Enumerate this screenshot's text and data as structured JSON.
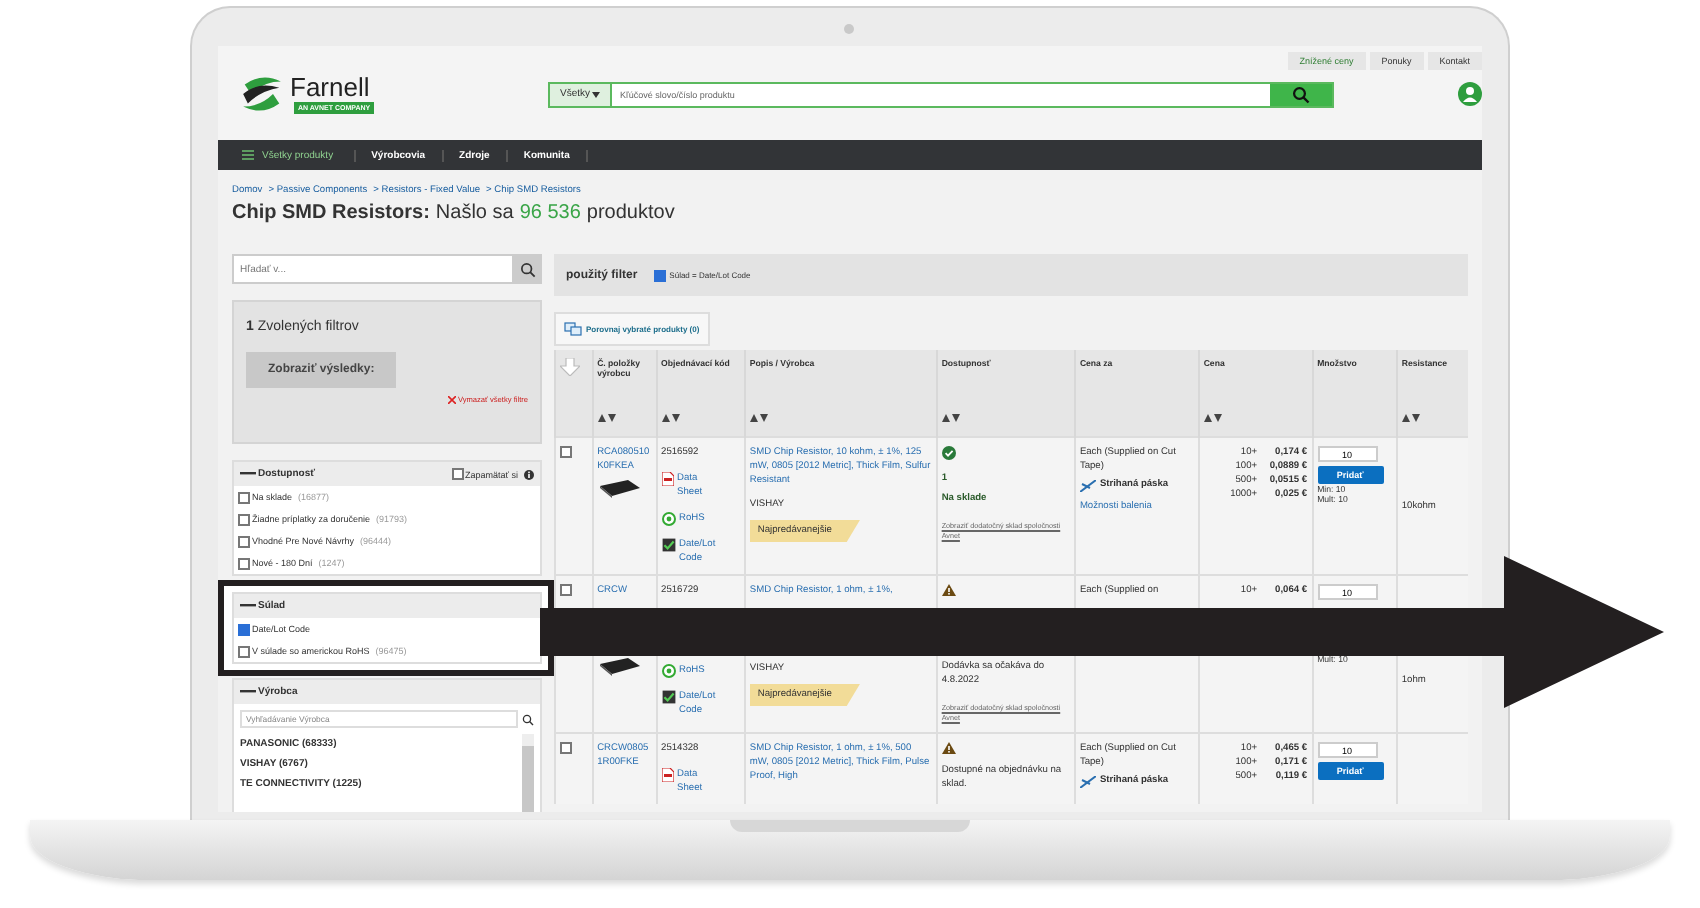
{
  "header": {
    "top_links": [
      "Znížené ceny",
      "Ponuky",
      "Kontakt"
    ],
    "logo": {
      "name": "Farnell",
      "tagline": "AN AVNET COMPANY"
    },
    "search": {
      "scope": "Všetky",
      "placeholder": "Kľúčové slovo/číslo produktu"
    }
  },
  "nav": {
    "menu_label": "Všetky produkty",
    "items": [
      "Výrobcovia",
      "Zdroje",
      "Komunita"
    ]
  },
  "breadcrumb": [
    "Domov",
    "> Passive Components",
    "> Resistors - Fixed Value",
    "> Chip SMD Resistors"
  ],
  "heading": {
    "category": "Chip SMD Resistors:",
    "found_prefix": "Našlo sa",
    "count": "96 536",
    "found_suffix": "produktov"
  },
  "sidebar": {
    "search_placeholder": "Hľadať v...",
    "selected_count": "1",
    "selected_label": "Zvolených filtrov",
    "show_button": "Zobraziť výsledky:",
    "clear_link": "Vymazať všetky filtre",
    "groups": [
      {
        "kind": "checklist",
        "title": "Dostupnosť",
        "highlighted": false,
        "remember": {
          "label": "Zapamätať si",
          "checked": false
        },
        "options": [
          {
            "label": "Na sklade",
            "count": "(16877)",
            "checked": false
          },
          {
            "label": "Žiadne príplatky za doručenie",
            "count": "(91793)",
            "checked": false
          },
          {
            "label": "Vhodné Pre Nové Návrhy",
            "count": "(96444)",
            "checked": false
          },
          {
            "label": "Nové - 180 Dní",
            "count": "(1247)",
            "checked": false
          }
        ]
      },
      {
        "kind": "checklist",
        "title": "Súlad",
        "highlighted": true,
        "options": [
          {
            "label": "Date/Lot Code",
            "checked": true
          },
          {
            "label": "V súlade so americkou RoHS",
            "count": "(96475)",
            "checked": false
          }
        ]
      },
      {
        "kind": "searchlist",
        "title": "Výrobca",
        "highlighted": false,
        "search_placeholder": "Vyhľadávanie Výrobca",
        "items": [
          "PANASONIC (68333)",
          "VISHAY (6767)",
          "TE CONNECTIVITY (1225)"
        ]
      }
    ]
  },
  "applied_filter": {
    "label": "použitý filter",
    "chip": {
      "label": "Súlad = Date/Lot Code",
      "checked": true
    }
  },
  "compare_button": "Porovnaj vybraté produkty (0)",
  "table": {
    "columns": [
      {
        "label": "Č. položky výrobcu",
        "sortable": true
      },
      {
        "label": "Objednávací kód",
        "sortable": true
      },
      {
        "label": "Popis / Výrobca",
        "sortable": true
      },
      {
        "label": "Dostupnosť",
        "sortable": true
      },
      {
        "label": "Cena za",
        "sortable": false
      },
      {
        "label": "Cena",
        "sortable": true
      },
      {
        "label": "Množstvo",
        "sortable": false
      },
      {
        "label": "Resistance",
        "sortable": true
      }
    ],
    "rows": [
      {
        "selected": false,
        "obscured": false,
        "part_number": "RCA080510K0FKEA",
        "image": true,
        "order_code": "2516592",
        "links": [
          {
            "kind": "datasheet",
            "label": "Data Sheet"
          },
          {
            "kind": "rohs",
            "label": "RoHS"
          },
          {
            "kind": "datelot",
            "label": "Date/Lot Code"
          }
        ],
        "description": "SMD Chip Resistor, 10 kohm, ± 1%, 125 mW, 0805 [2012 Metric], Thick Film, Sulfur Resistant",
        "manufacturer": "VISHAY",
        "badge": "Najpredávanejšie",
        "availability": {
          "kind": "in_stock",
          "quantity": "1",
          "text": "Na sklade",
          "link": "Zobraziť dodatočný sklad spoločnosti Avnet"
        },
        "unit": "Each (Supplied on Cut Tape)",
        "packaging": "Strihaná páska",
        "packaging_link": "Možnosti balenia",
        "prices": [
          {
            "qty": "10+",
            "price": "0,174 €"
          },
          {
            "qty": "100+",
            "price": "0,0889 €"
          },
          {
            "qty": "500+",
            "price": "0,0515 €"
          },
          {
            "qty": "1000+",
            "price": "0,025 €"
          }
        ],
        "quantity": "10",
        "add_button": "Pridať",
        "min": "Min: 10",
        "mult": "Mult: 10",
        "resistance": "10kohm"
      },
      {
        "selected": false,
        "obscured": true,
        "part_number": "CRCW",
        "image": true,
        "order_code": "2516729",
        "links": [
          {
            "kind": "rohs",
            "label": "RoHS"
          },
          {
            "kind": "datelot",
            "label": "Date/Lot Code"
          }
        ],
        "description": "SMD Chip Resistor, 1 ohm, ± 1%,",
        "manufacturer": "VISHAY",
        "badge": "Najpredávanejšie",
        "availability": {
          "kind": "warning",
          "text": "Dodávka sa očakáva do 4.8.2022",
          "link": "Zobraziť dodatočný sklad spoločnosti Avnet"
        },
        "unit": "Each (Supplied on",
        "prices": [
          {
            "qty": "10+",
            "price": "0,064 €"
          }
        ],
        "quantity": "10",
        "mult": "Mult: 10",
        "resistance": "1ohm"
      },
      {
        "selected": false,
        "obscured": false,
        "part_number": "CRCW08051R00FKE",
        "image": false,
        "order_code": "2514328",
        "links": [
          {
            "kind": "datasheet",
            "label": "Data Sheet"
          }
        ],
        "description": "SMD Chip Resistor, 1 ohm, ± 1%, 500 mW, 0805 [2012 Metric], Thick Film, Pulse Proof, High",
        "availability": {
          "kind": "warning",
          "text": "Dostupné na objednávku na sklad."
        },
        "unit": "Each (Supplied on Cut Tape)",
        "packaging": "Strihaná páska",
        "prices": [
          {
            "qty": "10+",
            "price": "0,465 €"
          },
          {
            "qty": "100+",
            "price": "0,171 €"
          },
          {
            "qty": "500+",
            "price": "0,119 €"
          }
        ],
        "quantity": "10",
        "add_button": "Pridať"
      }
    ]
  }
}
